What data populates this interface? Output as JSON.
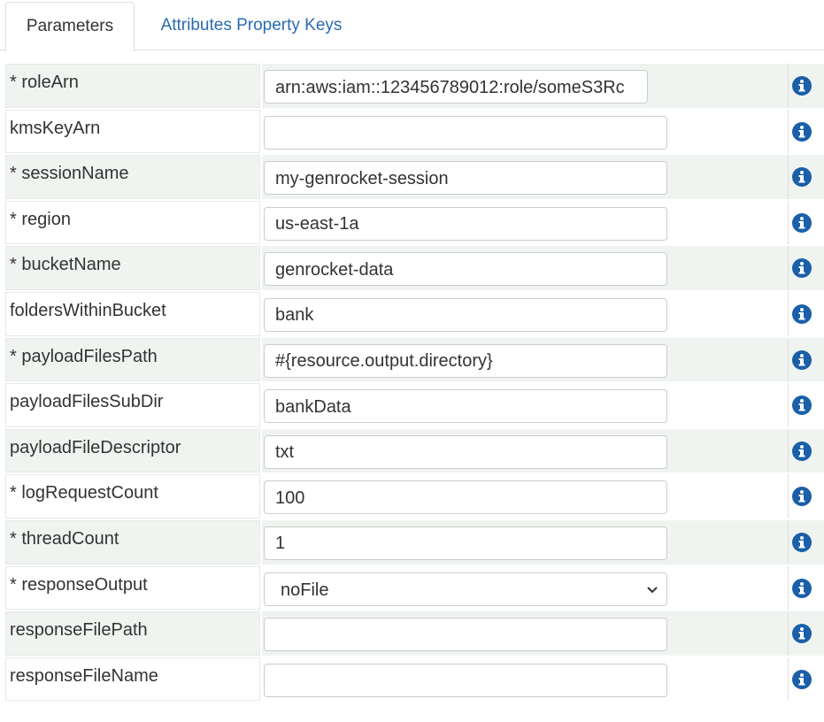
{
  "tabs": [
    {
      "label": "Parameters",
      "active": true
    },
    {
      "label": "Attributes Property Keys",
      "active": false
    }
  ],
  "colors": {
    "link": "#2a6bb0",
    "info_icon": "#1a5fa8",
    "row_shade": "#f0f4f0"
  },
  "rows": [
    {
      "label": "* roleArn",
      "value": "arn:aws:iam::123456789012:role/someS3Rc"
    },
    {
      "label": "kmsKeyArn",
      "value": ""
    },
    {
      "label": "* sessionName",
      "value": "my-genrocket-session"
    },
    {
      "label": "* region",
      "value": "us-east-1a"
    },
    {
      "label": "* bucketName",
      "value": "genrocket-data"
    },
    {
      "label": "foldersWithinBucket",
      "value": "bank"
    },
    {
      "label": "* payloadFilesPath",
      "value": "#{resource.output.directory}"
    },
    {
      "label": "payloadFilesSubDir",
      "value": "bankData"
    },
    {
      "label": "payloadFileDescriptor",
      "value": "txt"
    },
    {
      "label": "* logRequestCount",
      "value": "100"
    },
    {
      "label": "* threadCount",
      "value": "1"
    },
    {
      "label": "* responseOutput",
      "value": "noFile",
      "type": "select"
    },
    {
      "label": "responseFilePath",
      "value": ""
    },
    {
      "label": "responseFileName",
      "value": ""
    }
  ],
  "icons": {
    "info": "info-circle-icon",
    "dropdown": "chevron-down-icon"
  }
}
